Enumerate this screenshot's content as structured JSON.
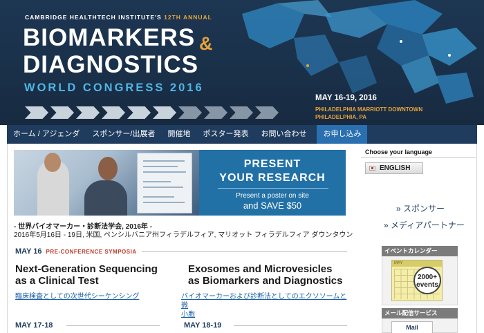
{
  "banner": {
    "org_text": "CAMBRIDGE HEALTHTECH INSTITUTE'S",
    "annual_text": "12TH ANNUAL",
    "title_line1": "BIOMARKERS",
    "title_amp": "&",
    "title_line2": "DIAGNOSTICS",
    "subtitle": "WORLD CONGRESS 2016",
    "date": "MAY 16-19, 2016",
    "venue_line1": "PHILADELPHIA MARRIOTT DOWNTOWN",
    "venue_line2": "PHILADELPHIA, PA",
    "colors": {
      "background": "#1d3652",
      "accent_orange": "#e8a33a",
      "accent_blue": "#4fb6e6"
    }
  },
  "nav": {
    "items": [
      {
        "label": "ホーム / アジェンダ"
      },
      {
        "label": "スポンサー/出展者"
      },
      {
        "label": "開催地"
      },
      {
        "label": "ポスター発表"
      },
      {
        "label": "お問い合わせ"
      },
      {
        "label": "お申し込み",
        "active": true
      }
    ],
    "colors": {
      "bar": "#1f3c5e",
      "active": "#2a6fb0"
    }
  },
  "promo": {
    "heading_line1": "PRESENT",
    "heading_line2": "YOUR RESEARCH",
    "sub_line1": "Present a poster on site",
    "sub_line2": "and SAVE $50"
  },
  "caption": {
    "line1": "- 世界バイオマーカー・診断法学会, 2016年 -",
    "line2": "2016年5月16日 - 19日, 米国, ペンシルバニア州フィラデルフィア, マリオット フィラデルフィア ダウンタウン"
  },
  "sections": {
    "may16": {
      "date": "MAY 16",
      "tag": "PRE-CONFERENCE SYMPOSIA"
    },
    "may1718": {
      "date": "MAY 17-18"
    },
    "may1819": {
      "date": "MAY 18-19"
    }
  },
  "tracks": [
    {
      "title_line1": "Next-Generation Sequencing",
      "title_line2": "as a Clinical Test",
      "link": "臨床検査としての次世代シーケンシング"
    },
    {
      "title_line1": "Exosomes and Microvesicles",
      "title_line2": "as Biomarkers and Diagnostics",
      "link_line1": "バイオマーカーおよび診断法としてのエクソソームと微",
      "link_line2": "小胞"
    }
  ],
  "sidebar": {
    "language_label": "Choose your language",
    "language_button": "ENGLISH",
    "links": [
      "» スポンサー",
      "» メディアパートナー"
    ],
    "event_calendar_head": "イベントカレンダー",
    "calendar_month": "MAY",
    "calendar_badge_line1": "2000+",
    "calendar_badge_line2": "events",
    "mail_head": "メール配信サービス",
    "mail_text": "Mail"
  }
}
